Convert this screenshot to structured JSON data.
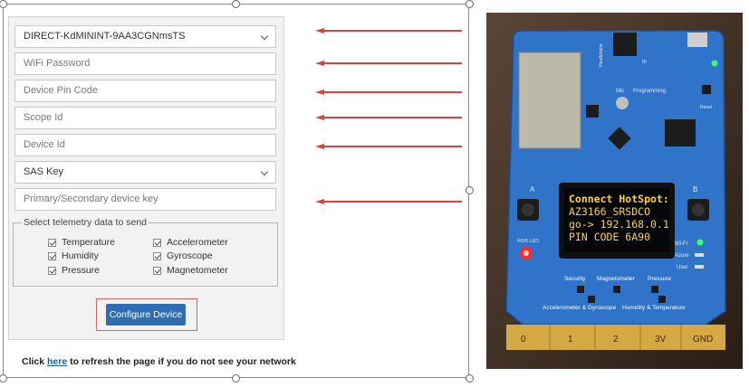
{
  "form": {
    "network_select": "DIRECT-KdMININT-9AA3CGNmsTS",
    "wifi_password_placeholder": "WiFi Password",
    "device_pin_placeholder": "Device Pin Code",
    "scope_id_placeholder": "Scope Id",
    "device_id_placeholder": "Device Id",
    "auth_select": "SAS Key",
    "device_key_placeholder": "Primary/Secondary device key",
    "telemetry_legend": "Select telemetry data to send",
    "telemetry_options": [
      {
        "label": "Temperature",
        "checked": true
      },
      {
        "label": "Humidity",
        "checked": true
      },
      {
        "label": "Pressure",
        "checked": true
      },
      {
        "label": "Accelerometer",
        "checked": true
      },
      {
        "label": "Gyroscope",
        "checked": true
      },
      {
        "label": "Magnetometer",
        "checked": true
      }
    ],
    "configure_button": "Configure Device",
    "refresh_prefix": "Click ",
    "refresh_link": "here",
    "refresh_suffix": " to refresh the page if you do not see your network"
  },
  "device_photo": {
    "oled_lines": [
      "Connect HotSpot:",
      "AZ3166_SRSDCO",
      "go-> 192.168.0.1",
      "PIN CODE 6A90"
    ],
    "board_labels": {
      "headphone": "Headphone",
      "ir": "IR",
      "mic": "Mic",
      "programming": "Programming",
      "reset": "Reset",
      "button_a": "A",
      "button_b": "B",
      "rgb_led": "RGB LED",
      "wifi": "Wi-Fi",
      "azure": "Azure",
      "user": "User",
      "security": "Security",
      "magnetometer": "Magnetometer",
      "pressure": "Pressure",
      "accel_gyro": "Accelerometer & Gyroscope",
      "humidity_temp": "Humidity & Temperature",
      "pins": [
        "0",
        "1",
        "2",
        "3V",
        "GND"
      ]
    }
  },
  "colors": {
    "accent_button": "#2f6db5",
    "arrow": "#e0403a",
    "highlight": "#e0605a",
    "board_blue": "#2f74c8",
    "oled_text": "#ffd23a"
  }
}
